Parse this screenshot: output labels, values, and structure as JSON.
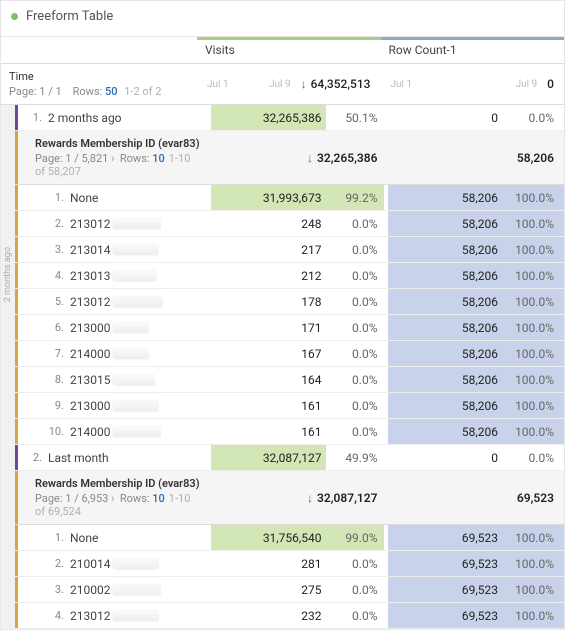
{
  "title": "Freeform Table",
  "columns": {
    "visits": "Visits",
    "rowCount": "Row Count-1"
  },
  "dateLabels": {
    "left": "Jul 1",
    "right": "Jul 9"
  },
  "time": {
    "label": "Time",
    "pageLabel": "Page:",
    "page": "1 / 1",
    "rowsLabel": "Rows:",
    "rows": "50",
    "range": "1-2 of 2"
  },
  "totals": {
    "visits": "64,352,513",
    "rowCount": "0"
  },
  "periods": [
    {
      "num": "1.",
      "label": "2 months ago",
      "visits": "32,265,386",
      "visitsPct": "50.1%",
      "rowCount": "0",
      "rowCountPct": "0.0%",
      "visitsBar": 65,
      "rowCountBar": 0,
      "sideLabel": "2 months ago",
      "sub": {
        "title": "Rewards Membership ID (evar83)",
        "pageLabel": "Page:",
        "page": "1 / 5,821",
        "chev": "›",
        "rowsLabel": "Rows:",
        "rows": "10",
        "range": "1-10 of 58,207",
        "visitsTotal": "32,265,386",
        "rowCountTotal": "58,206",
        "rows_data": [
          {
            "n": "1.",
            "label": "None",
            "v": "31,993,673",
            "vp": "99.2%",
            "r": "58,206",
            "rp": "100.0%",
            "vbar": 98,
            "rbar": 100,
            "redact": 0
          },
          {
            "n": "2.",
            "label": "213012",
            "v": "248",
            "vp": "0.0%",
            "r": "58,206",
            "rp": "100.0%",
            "vbar": 0,
            "rbar": 100,
            "redact": 48
          },
          {
            "n": "3.",
            "label": "213014",
            "v": "217",
            "vp": "0.0%",
            "r": "58,206",
            "rp": "100.0%",
            "vbar": 0,
            "rbar": 100,
            "redact": 46
          },
          {
            "n": "4.",
            "label": "213013",
            "v": "212",
            "vp": "0.0%",
            "r": "58,206",
            "rp": "100.0%",
            "vbar": 0,
            "rbar": 100,
            "redact": 44
          },
          {
            "n": "5.",
            "label": "213012",
            "v": "178",
            "vp": "0.0%",
            "r": "58,206",
            "rp": "100.0%",
            "vbar": 0,
            "rbar": 100,
            "redact": 50
          },
          {
            "n": "6.",
            "label": "213000",
            "v": "171",
            "vp": "0.0%",
            "r": "58,206",
            "rp": "100.0%",
            "vbar": 0,
            "rbar": 100,
            "redact": 36
          },
          {
            "n": "7.",
            "label": "214000",
            "v": "167",
            "vp": "0.0%",
            "r": "58,206",
            "rp": "100.0%",
            "vbar": 0,
            "rbar": 100,
            "redact": 36
          },
          {
            "n": "8.",
            "label": "213015",
            "v": "164",
            "vp": "0.0%",
            "r": "58,206",
            "rp": "100.0%",
            "vbar": 0,
            "rbar": 100,
            "redact": 42
          },
          {
            "n": "9.",
            "label": "213000",
            "v": "161",
            "vp": "0.0%",
            "r": "58,206",
            "rp": "100.0%",
            "vbar": 0,
            "rbar": 100,
            "redact": 46
          },
          {
            "n": "10.",
            "label": "214000",
            "v": "161",
            "vp": "0.0%",
            "r": "58,206",
            "rp": "100.0%",
            "vbar": 0,
            "rbar": 100,
            "redact": 48
          }
        ]
      }
    },
    {
      "num": "2.",
      "label": "Last month",
      "visits": "32,087,127",
      "visitsPct": "49.9%",
      "rowCount": "0",
      "rowCountPct": "0.0%",
      "visitsBar": 65,
      "rowCountBar": 0,
      "sideLabel": "",
      "sub": {
        "title": "Rewards Membership ID (evar83)",
        "pageLabel": "Page:",
        "page": "1 / 6,953",
        "chev": "›",
        "rowsLabel": "Rows:",
        "rows": "10",
        "range": "1-10 of 69,524",
        "visitsTotal": "32,087,127",
        "rowCountTotal": "69,523",
        "rows_data": [
          {
            "n": "1.",
            "label": "None",
            "v": "31,756,540",
            "vp": "99.0%",
            "r": "69,523",
            "rp": "100.0%",
            "vbar": 98,
            "rbar": 100,
            "redact": 0
          },
          {
            "n": "2.",
            "label": "210014",
            "v": "281",
            "vp": "0.0%",
            "r": "69,523",
            "rp": "100.0%",
            "vbar": 0,
            "rbar": 100,
            "redact": 46
          },
          {
            "n": "3.",
            "label": "210002",
            "v": "275",
            "vp": "0.0%",
            "r": "69,523",
            "rp": "100.0%",
            "vbar": 0,
            "rbar": 100,
            "redact": 48
          },
          {
            "n": "4.",
            "label": "213012",
            "v": "232",
            "vp": "0.0%",
            "r": "69,523",
            "rp": "100.0%",
            "vbar": 0,
            "rbar": 100,
            "redact": 46
          }
        ]
      }
    }
  ]
}
